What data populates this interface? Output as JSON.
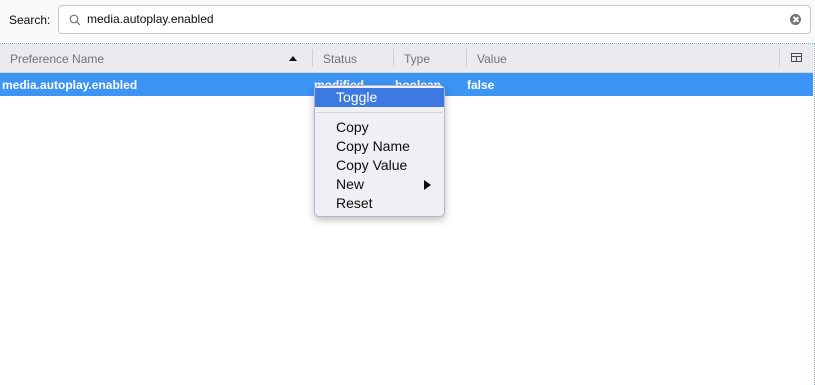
{
  "search": {
    "label": "Search:",
    "value": "media.autoplay.enabled"
  },
  "table": {
    "columns": [
      "Preference Name",
      "Status",
      "Type",
      "Value"
    ],
    "sorted_column": "Preference Name",
    "sort_direction": "ascending",
    "rows": [
      {
        "name": "media.autoplay.enabled",
        "status": "modified",
        "type": "boolean",
        "value": "false"
      }
    ]
  },
  "context_menu": {
    "items": [
      "Toggle",
      "Copy",
      "Copy Name",
      "Copy Value",
      "New",
      "Reset"
    ],
    "highlighted": "Toggle",
    "has_submenu": "New"
  },
  "colors": {
    "selection": "#3c94f4",
    "menu_highlight": "#3c79e0",
    "header_bg": "#ebebef"
  }
}
